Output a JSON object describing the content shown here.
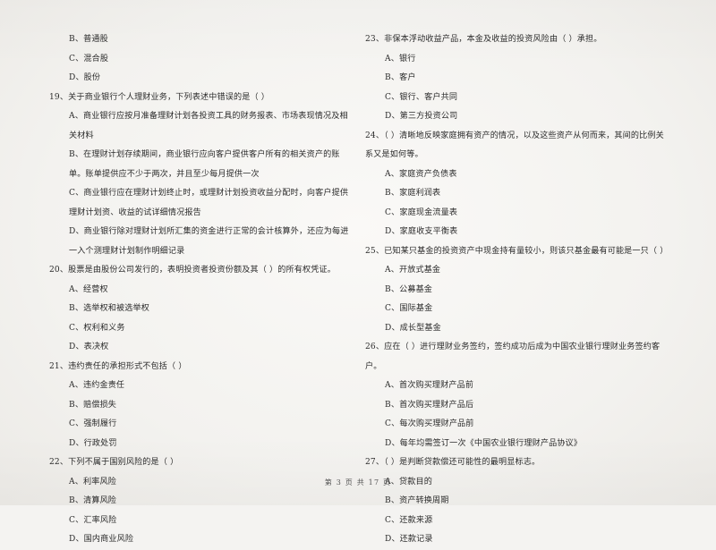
{
  "document": {
    "type": "exam-paper",
    "language": "zh-CN",
    "footer": "第 3 页  共 17 页"
  },
  "left_column": {
    "orphan_options": [
      "B、普通股",
      "C、混合股",
      "D、股份"
    ],
    "questions": [
      {
        "number": "19",
        "stem": "19、关于商业银行个人理财业务，下列表述中错误的是（    ）",
        "options": [
          "A、商业银行应按月准备理财计划各投资工具的财务报表、市场表现情况及相关材料",
          "B、在理财计划存续期间，商业银行应向客户提供客户所有的相关资产的账单。账单提供应不少于两次，并且至少每月提供一次",
          "C、商业银行应在理财计划终止时，或理财计划投资收益分配时，向客户提供理财计划资、收益的试详细情况报告",
          "D、商业银行除对理财计划所汇集的资金进行正常的会计核算外，还应为每进一入个测理财计划制作明细记录"
        ]
      },
      {
        "number": "20",
        "stem": "20、股票是由股份公司发行的，表明投资者投资份额及其（    ）的所有权凭证。",
        "options": [
          "A、经营权",
          "B、选举权和被选举权",
          "C、权利和义务",
          "D、表决权"
        ]
      },
      {
        "number": "21",
        "stem": "21、违约责任的承担形式不包括（    ）",
        "options": [
          "A、违约金责任",
          "B、赔偿损失",
          "C、强制履行",
          "D、行政处罚"
        ]
      },
      {
        "number": "22",
        "stem": "22、下列不属于国别风险的是（    ）",
        "options": [
          "A、利率风险",
          "B、清算风险",
          "C、汇率风险",
          "D、国内商业风险"
        ]
      }
    ]
  },
  "right_column": {
    "questions": [
      {
        "number": "23",
        "stem": "23、非保本浮动收益产品，本金及收益的投资风险由（    ）承担。",
        "options": [
          "A、银行",
          "B、客户",
          "C、银行、客户共同",
          "D、第三方投资公司"
        ]
      },
      {
        "number": "24",
        "stem": "24、（    ）清晰地反映家庭拥有资产的情况，以及这些资产从何而来，其间的比例关系又是如何等。",
        "options": [
          "A、家庭资产负债表",
          "B、家庭利润表",
          "C、家庭现金流量表",
          "D、家庭收支平衡表"
        ]
      },
      {
        "number": "25",
        "stem": "25、已知某只基金的投资资产中现金持有量较小，则该只基金最有可能是一只（    ）",
        "options": [
          "A、开放式基金",
          "B、公募基金",
          "C、国际基金",
          "D、成长型基金"
        ]
      },
      {
        "number": "26",
        "stem": "26、应在（    ）进行理财业务签约，签约成功后成为中国农业银行理财业务签约客户。",
        "options": [
          "A、首次购买理财产品前",
          "B、首次购买理财产品后",
          "C、每次购买理财产品前",
          "D、每年均需签订一次《中国农业银行理财产品协议》"
        ]
      },
      {
        "number": "27",
        "stem": "27、（    ）是判断贷款偿还可能性的最明显标志。",
        "options": [
          "A、贷款目的",
          "B、资产转换周期",
          "C、还款来源",
          "D、还款记录"
        ]
      }
    ]
  }
}
